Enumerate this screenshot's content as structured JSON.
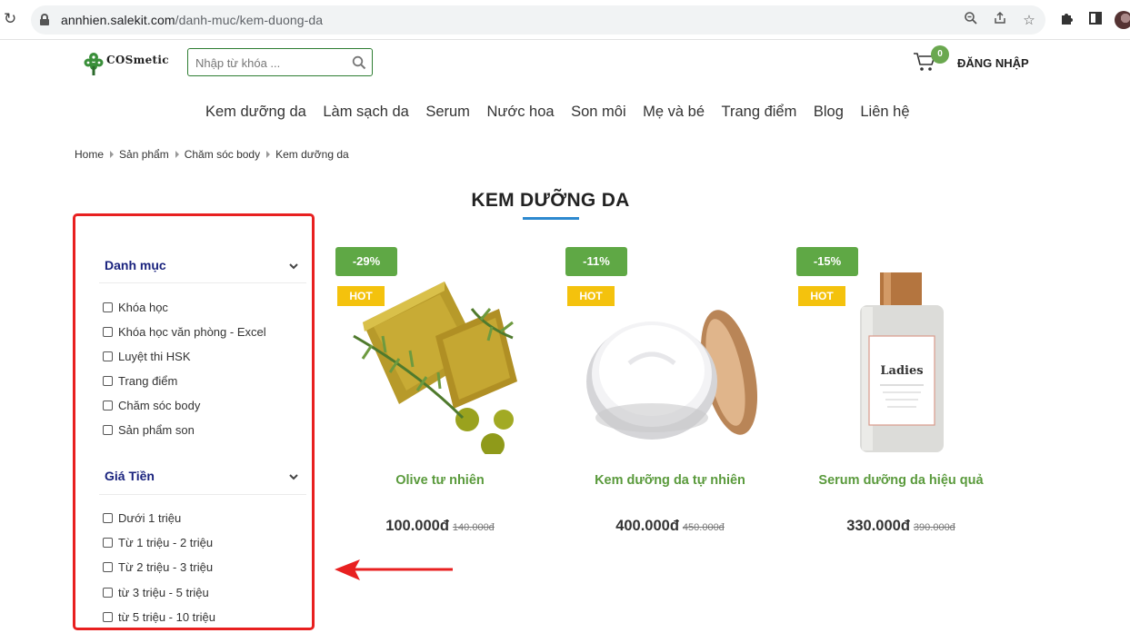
{
  "browser": {
    "url_host": "annhien.salekit.com",
    "url_path": "/danh-muc/kem-duong-da"
  },
  "header": {
    "logo_text": "COSmetic",
    "search_placeholder": "Nhập từ khóa ...",
    "cart_count": "0",
    "login_label": "ĐĂNG NHẬP"
  },
  "nav": [
    "Kem dưỡng da",
    "Làm sạch da",
    "Serum",
    "Nước hoa",
    "Son môi",
    "Mẹ và bé",
    "Trang điểm",
    "Blog",
    "Liên hệ"
  ],
  "breadcrumb": [
    "Home",
    "Sản phẩm",
    "Chăm sóc body",
    "Kem dưỡng da"
  ],
  "page_title": "KEM DƯỠNG DA",
  "filters": {
    "category_title": "Danh mục",
    "categories": [
      "Khóa học",
      "Khóa học văn phòng - Excel",
      "Luyệt thi HSK",
      "Trang điểm",
      "Chăm sóc body",
      "Sản phẩm son"
    ],
    "price_title": "Giá Tiền",
    "prices": [
      "Dưới 1 triệu",
      "Từ 1 triệu - 2 triệu",
      "Từ 2 triệu - 3 triệu",
      "từ 3 triệu - 5 triệu",
      "từ 5 triệu - 10 triệu"
    ]
  },
  "products": [
    {
      "discount": "-29%",
      "badge": "HOT",
      "name": "Olive tư nhiên",
      "price": "100.000đ",
      "old_price": "140.000đ",
      "image_icon": "olive-soap-image"
    },
    {
      "discount": "-11%",
      "badge": "HOT",
      "name": "Kem dưỡng da tự nhiên",
      "price": "400.000đ",
      "old_price": "450.000đ",
      "image_icon": "cream-jar-image"
    },
    {
      "discount": "-15%",
      "badge": "HOT",
      "name": "Serum dưỡng da hiệu quả",
      "price": "330.000đ",
      "old_price": "390.000đ",
      "image_icon": "serum-bottle-image",
      "bottle_label": "Ladies"
    }
  ],
  "colors": {
    "accent_green": "#5fa845",
    "hot_yellow": "#f4c20d",
    "annotation_red": "#e82020",
    "title_underline": "#2d89cf"
  }
}
